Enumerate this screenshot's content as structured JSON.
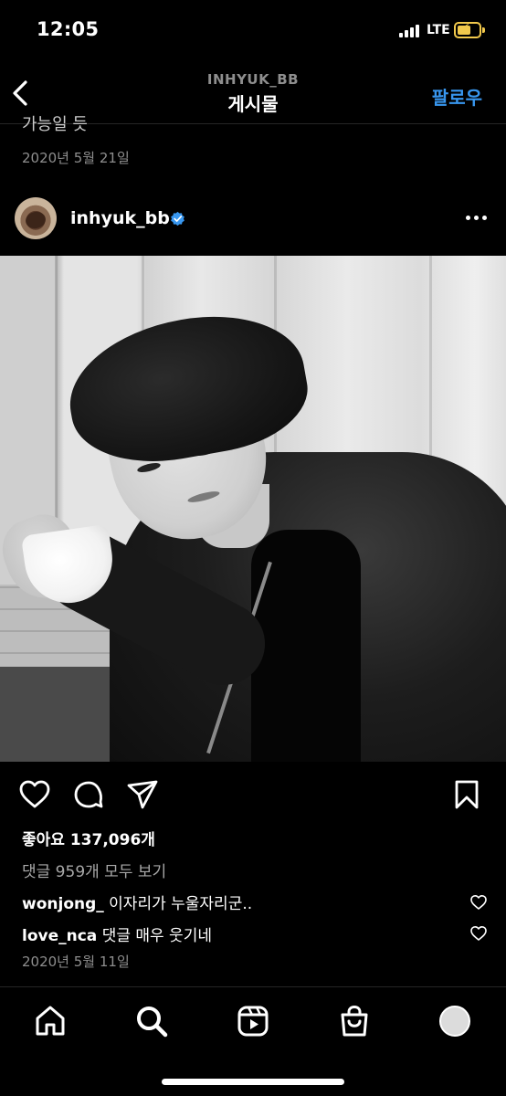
{
  "status_bar": {
    "time": "12:05",
    "network": "LTE"
  },
  "header": {
    "username": "INHYUK_BB",
    "title": "게시물",
    "follow_label": "팔로우"
  },
  "previous_post": {
    "caption_fragment": "가능일 듯",
    "date": "2020년 5월 21일"
  },
  "post": {
    "username": "inhyuk_bb",
    "verified": true,
    "likes": "좋아요 137,096개",
    "view_comments": "댓글 959개 모두 보기",
    "comments": [
      {
        "user": "wonjong_",
        "text": "이자리가 누울자리군.."
      },
      {
        "user": "love_nca",
        "text": "댓글 매우 웃기네"
      }
    ],
    "date": "2020년 5월 11일"
  },
  "icons": {
    "back": "chevron-left-icon",
    "more": "more-horizontal-icon",
    "like": "heart-icon",
    "comment": "comment-icon",
    "share": "send-icon",
    "save": "bookmark-icon",
    "home": "home-icon",
    "search": "search-icon",
    "reels": "reels-icon",
    "shop": "shop-icon"
  },
  "colors": {
    "accent": "#3897f0",
    "verified": "#3897f0",
    "battery": "#f2c94c",
    "muted": "#8e8e8e"
  }
}
